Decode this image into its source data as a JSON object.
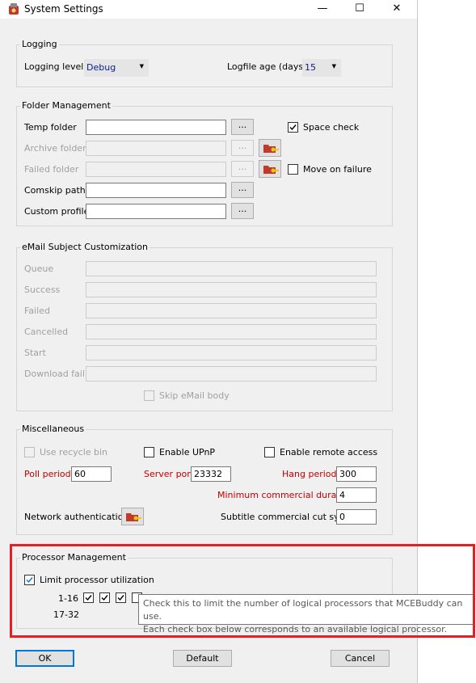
{
  "window": {
    "title": "System Settings",
    "minimize": "—",
    "maximize": "☐",
    "close": "✕"
  },
  "logging": {
    "group_title": "Logging",
    "level_label": "Logging level",
    "level_value": "Debug",
    "age_label": "Logfile age (days)",
    "age_value": "15"
  },
  "folders": {
    "group_title": "Folder Management",
    "temp_label": "Temp folder",
    "archive_label": "Archive folder",
    "failed_label": "Failed folder",
    "comskip_label": "Comskip path",
    "custom_label": "Custom profile",
    "browse": "...",
    "space_check_label": "Space check",
    "space_check_checked": true,
    "move_on_failure_label": "Move on failure",
    "move_on_failure_checked": false
  },
  "email": {
    "group_title": "eMail Subject Customization",
    "queue_label": "Queue",
    "success_label": "Success",
    "failed_label": "Failed",
    "cancelled_label": "Cancelled",
    "start_label": "Start",
    "download_fail_label": "Download fail",
    "skip_body_label": "Skip eMail body"
  },
  "misc": {
    "group_title": "Miscellaneous",
    "recycle_label": "Use recycle bin",
    "upnp_label": "Enable UPnP",
    "remote_label": "Enable remote access",
    "poll_label": "Poll period",
    "poll_value": "60",
    "server_port_label": "Server port",
    "server_port_value": "23332",
    "hang_label": "Hang period",
    "hang_value": "300",
    "min_comm_label": "Minimum commercial duration",
    "min_comm_value": "4",
    "net_auth_label": "Network authentication",
    "subtitle_cut_label": "Subtitle commercial cut sync",
    "subtitle_cut_value": "0"
  },
  "processor": {
    "group_title": "Processor Management",
    "limit_label": "Limit processor utilization",
    "limit_checked": true,
    "row1_label": "1-16",
    "row2_label": "17-32"
  },
  "tooltip": {
    "line1": "Check this to limit the number of logical processors that MCEBuddy can use.",
    "line2": "Each check box below corresponds to an available logical processor."
  },
  "buttons": {
    "ok": "OK",
    "default": "Default",
    "cancel": "Cancel"
  },
  "colors": {
    "highlight_border": "#e52020",
    "required_label": "#c00000",
    "combo_text": "#0b1e8b",
    "default_button_border": "#0078d7"
  },
  "icons": [
    "app-icon",
    "folder-key-icon",
    "check-icon"
  ]
}
